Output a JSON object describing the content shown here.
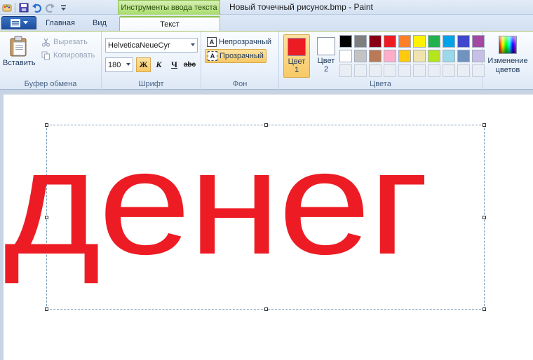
{
  "titlebar": {
    "context_tab_title": "Инструменты ввода текста",
    "window_title": "Новый точечный рисунок.bmp - Paint"
  },
  "tabs": {
    "main": "Главная",
    "view": "Вид",
    "text": "Текст"
  },
  "clipboard": {
    "paste_label": "Вставить",
    "cut_label": "Вырезать",
    "copy_label": "Копировать",
    "group_label": "Буфер обмена"
  },
  "font": {
    "family": "HelveticaNeueCyr",
    "size": "180",
    "bold_label": "Ж",
    "italic_label": "К",
    "underline_label": "Ч",
    "strike_label": "abc",
    "group_label": "Шрифт"
  },
  "background": {
    "opaque_label": "Непрозрачный",
    "transparent_label": "Прозрачный",
    "group_label": "Фон"
  },
  "colors": {
    "color1_label_a": "Цвет",
    "color1_label_b": "1",
    "color2_label_a": "Цвет",
    "color2_label_b": "2",
    "color1_value": "#ed1c24",
    "color2_value": "#ffffff",
    "palette_row1": [
      "#000000",
      "#7f7f7f",
      "#880015",
      "#ed1c24",
      "#ff7f27",
      "#fff200",
      "#22b14c",
      "#00a2e8",
      "#3f48cc",
      "#a349a4"
    ],
    "palette_row2": [
      "#ffffff",
      "#c3c3c3",
      "#b97a57",
      "#ffaec9",
      "#ffc90e",
      "#efe4b0",
      "#b5e61d",
      "#99d9ea",
      "#7092be",
      "#c8bfe7"
    ],
    "edit_label_a": "Изменение",
    "edit_label_b": "цветов",
    "group_label": "Цвета"
  },
  "canvas": {
    "text": "денег",
    "text_color": "#ed1c24"
  }
}
